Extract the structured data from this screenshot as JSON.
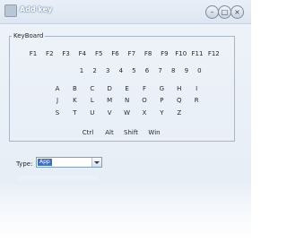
{
  "window": {
    "title": "Add key"
  },
  "keyboard": {
    "legend": "KeyBoard",
    "rows": [
      [
        "F1",
        "F2",
        "F3",
        "F4",
        "F5",
        "F6",
        "F7",
        "F8",
        "F9",
        "F10",
        "F11",
        "F12"
      ],
      [
        "1",
        "2",
        "3",
        "4",
        "5",
        "6",
        "7",
        "8",
        "9",
        "0"
      ],
      [
        "A",
        "B",
        "C",
        "D",
        "E",
        "F",
        "G",
        "H",
        "I"
      ],
      [
        "J",
        "K",
        "L",
        "M",
        "N",
        "O",
        "P",
        "Q",
        "R"
      ],
      [
        "S",
        "T",
        "U",
        "V",
        "W",
        "X",
        "Y",
        "Z"
      ],
      [
        "Ctrl",
        "Alt",
        "Shift",
        "Win"
      ]
    ]
  },
  "type": {
    "label": "Type:",
    "value": "App"
  },
  "icons": {
    "minimize": "minimize-icon",
    "maximize": "maximize-icon",
    "close": "close-icon",
    "dropdown": "chevron-down-icon"
  }
}
